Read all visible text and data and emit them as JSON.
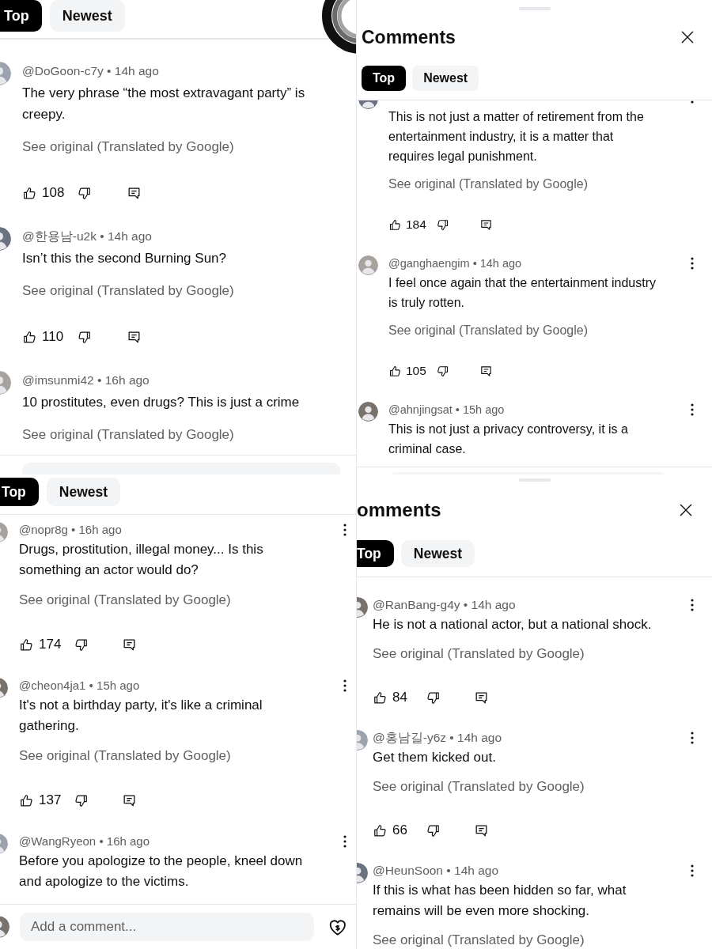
{
  "panels": [
    {
      "tabs": [
        {
          "label": "Top",
          "selected": true
        },
        {
          "label": "Newest",
          "selected": false
        }
      ],
      "comments": [
        {
          "meta": "@DoGoon-c7y • 14h ago",
          "body": [
            "The very phrase “the most extravagant party” is",
            "creepy."
          ],
          "see_original": "See original (Translated by Google)",
          "likes": "108"
        },
        {
          "meta": "@한용남-u2k • 14h ago",
          "body": [
            "Isn’t this the second Burning Sun?"
          ],
          "see_original": "See original (Translated by Google)",
          "likes": "110"
        },
        {
          "meta": "@imsunmi42 • 16h ago",
          "body": [
            "10 prostitutes, even drugs? This is just a crime"
          ],
          "see_original": "See original (Translated by Google)"
        }
      ]
    },
    {
      "title": "Comments",
      "tabs": [
        {
          "label": "Top",
          "selected": true
        },
        {
          "label": "Newest",
          "selected": false
        }
      ],
      "comments": [
        {
          "body": [
            "This is not just a matter of retirement from the",
            "entertainment industry, it is a matter that",
            "requires legal punishment."
          ],
          "see_original": "See original (Translated by Google)",
          "likes": "184"
        },
        {
          "meta": "@ganghaengim • 14h ago",
          "body": [
            "I feel once again that the entertainment industry",
            "is truly rotten."
          ],
          "see_original": "See original (Translated by Google)",
          "likes": "105"
        },
        {
          "meta": "@ahnjingsat • 15h ago",
          "body": [
            "This is not just a privacy controversy, it is a",
            "criminal case."
          ]
        }
      ]
    },
    {
      "tabs": [
        {
          "label": "Top",
          "selected": true
        },
        {
          "label": "Newest",
          "selected": false
        }
      ],
      "comments": [
        {
          "meta": "@nopr8g • 16h ago",
          "body": [
            "Drugs, prostitution, illegal money... Is this",
            "something an actor would do?"
          ],
          "see_original": "See original (Translated by Google)",
          "likes": "174"
        },
        {
          "meta": "@cheon4ja1 • 15h ago",
          "body": [
            "It's not a birthday party, it's like a criminal",
            "gathering."
          ],
          "see_original": "See original (Translated by Google)",
          "likes": "137"
        },
        {
          "meta": "@WangRyeon • 16h ago",
          "body": [
            "Before you apologize to the people, kneel down",
            "and apologize to the victims."
          ]
        }
      ],
      "comment_box": {
        "placeholder": "Add a comment..."
      }
    },
    {
      "title": "omments",
      "tabs": [
        {
          "label": "Top",
          "selected": true
        },
        {
          "label": "Newest",
          "selected": false
        }
      ],
      "comments": [
        {
          "meta": "@RanBang-g4y • 14h ago",
          "body": [
            "He is not a national actor, but a national shock."
          ],
          "see_original": "See original (Translated by Google)",
          "likes": "84"
        },
        {
          "meta": "@홍남길-y6z • 14h ago",
          "body": [
            "Get them kicked out."
          ],
          "see_original": "See original (Translated by Google)",
          "likes": "66"
        },
        {
          "meta": "@HeunSoon • 14h ago",
          "body": [
            "If this is what has been hidden so far, what",
            "remains will be even more shocking."
          ],
          "see_original": "See original (Translated by Google)"
        }
      ]
    }
  ]
}
